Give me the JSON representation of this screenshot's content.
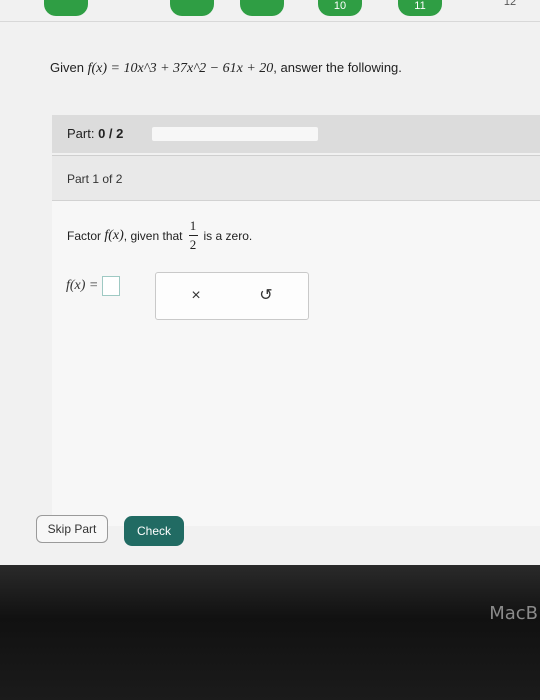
{
  "top_nav": {
    "questions": [
      "",
      "",
      "",
      "10",
      "11"
    ],
    "current_number": "12"
  },
  "prompt": {
    "lead": "Given",
    "function": "f(x) = 10x^3 + 37x^2 − 61x + 20",
    "trail": ", answer the following."
  },
  "part": {
    "label": "Part:",
    "value": "0 / 2",
    "progress_fraction": 0.0
  },
  "subpart": {
    "label": "Part 1 of 2"
  },
  "question": {
    "lead": "Factor",
    "func": "f(x)",
    "middle": ", given that",
    "fraction_numerator": "1",
    "fraction_denominator": "2",
    "trail": "is a zero."
  },
  "answer": {
    "label": "f(x) =",
    "value": ""
  },
  "tools": {
    "clear_symbol": "×",
    "undo_symbol": "↺"
  },
  "buttons": {
    "skip": "Skip Part",
    "check": "Check"
  },
  "bezel": {
    "brand": "MacB"
  },
  "colors": {
    "accent": "#216b63",
    "nav_green": "#2f9e44"
  }
}
